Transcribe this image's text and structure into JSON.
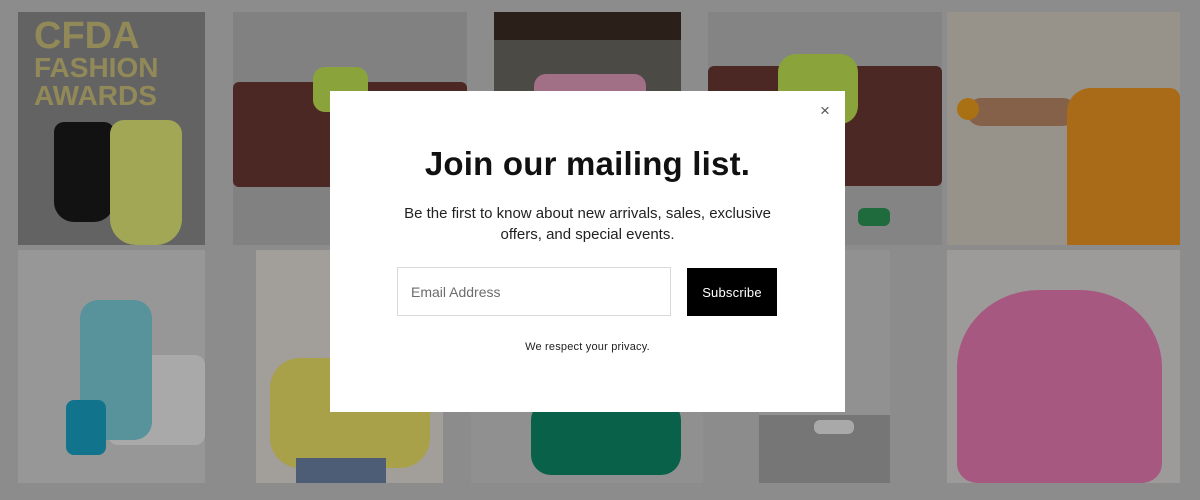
{
  "gallery": {
    "tiles": [
      {
        "name": "photo-cfda-event",
        "bg": "#8f8f8f",
        "accent": "#e7f07a"
      },
      {
        "name": "photo-lounge-couch",
        "bg": "#b9b9b9",
        "accent": "#7a3a32"
      },
      {
        "name": "photo-model-pink-sleeves",
        "bg": "#6e6a63",
        "accent": "#e7a0c0"
      },
      {
        "name": "photo-lime-dress-couch",
        "bg": "#bdbdbd",
        "accent": "#c6ea54"
      },
      {
        "name": "photo-orange-ruffle",
        "bg": "#d8d3c8",
        "accent": "#f29a23"
      },
      {
        "name": "photo-blue-outfit",
        "bg": "#d8d8d8",
        "accent": "#7fd3e0"
      },
      {
        "name": "photo-yellow-top",
        "bg": "#e8e2dc",
        "accent": "#f3e56a"
      },
      {
        "name": "photo-green-gown",
        "bg": "#cfcfcf",
        "accent": "#0f8b6b"
      },
      {
        "name": "photo-white-shoes",
        "bg": "#d0d0d0",
        "accent": "#f3f3f3"
      },
      {
        "name": "photo-pink-gown",
        "bg": "#e1dfdb",
        "accent": "#ef7fb8"
      }
    ],
    "overlay_color": "rgba(0,0,0,0.30)",
    "cfda_logo_text": [
      "CFDA",
      "FASHION",
      "AWARDS"
    ]
  },
  "modal": {
    "close_label": "×",
    "title": "Join our mailing list.",
    "subtitle": "Be the first to know about new arrivals, sales, exclusive offers, and special events.",
    "email_placeholder": "Email Address",
    "email_value": "",
    "subscribe_label": "Subscribe",
    "privacy_text": "We respect your privacy."
  }
}
